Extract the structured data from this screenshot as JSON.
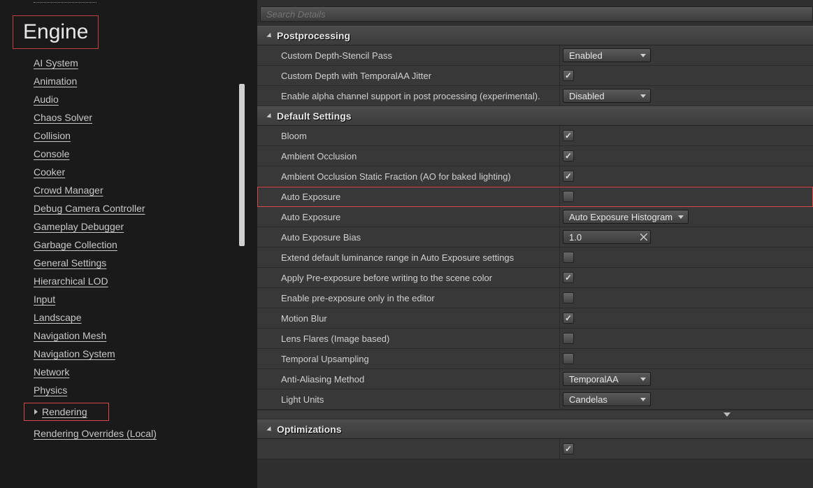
{
  "sidebar": {
    "category": "Engine",
    "items": [
      "AI System",
      "Animation",
      "Audio",
      "Chaos Solver",
      "Collision",
      "Console",
      "Cooker",
      "Crowd Manager",
      "Debug Camera Controller",
      "Gameplay Debugger",
      "Garbage Collection",
      "General Settings",
      "Hierarchical LOD",
      "Input",
      "Landscape",
      "Navigation Mesh",
      "Navigation System",
      "Network",
      "Physics",
      "Rendering",
      "Rendering Overrides (Local)"
    ],
    "selected_index": 19
  },
  "search": {
    "placeholder": "Search Details"
  },
  "sections": [
    {
      "title": "Postprocessing",
      "rows": [
        {
          "label": "Custom Depth-Stencil Pass",
          "type": "dropdown",
          "value": "Enabled"
        },
        {
          "label": "Custom Depth with TemporalAA Jitter",
          "type": "check",
          "value": true
        },
        {
          "label": "Enable alpha channel support in post processing (experimental).",
          "type": "dropdown",
          "value": "Disabled"
        }
      ]
    },
    {
      "title": "Default Settings",
      "rows": [
        {
          "label": "Bloom",
          "type": "check",
          "value": true
        },
        {
          "label": "Ambient Occlusion",
          "type": "check",
          "value": true
        },
        {
          "label": "Ambient Occlusion Static Fraction (AO for baked lighting)",
          "type": "check",
          "value": true
        },
        {
          "label": "Auto Exposure",
          "type": "check",
          "value": false,
          "highlighted": true
        },
        {
          "label": "Auto Exposure",
          "type": "dropdown",
          "value": "Auto Exposure Histogram",
          "wide": true
        },
        {
          "label": "Auto Exposure Bias",
          "type": "spin",
          "value": "1.0"
        },
        {
          "label": "Extend default luminance range in Auto Exposure settings",
          "type": "check",
          "value": false
        },
        {
          "label": "Apply Pre-exposure before writing to the scene color",
          "type": "check",
          "value": true
        },
        {
          "label": "Enable pre-exposure only in the editor",
          "type": "check",
          "value": false
        },
        {
          "label": "Motion Blur",
          "type": "check",
          "value": true
        },
        {
          "label": "Lens Flares (Image based)",
          "type": "check",
          "value": false
        },
        {
          "label": "Temporal Upsampling",
          "type": "check",
          "value": false
        },
        {
          "label": "Anti-Aliasing Method",
          "type": "dropdown",
          "value": "TemporalAA"
        },
        {
          "label": "Light Units",
          "type": "dropdown",
          "value": "Candelas"
        }
      ],
      "expander": true
    },
    {
      "title": "Optimizations",
      "rows": [
        {
          "label": "",
          "type": "check",
          "value": true
        }
      ]
    }
  ]
}
